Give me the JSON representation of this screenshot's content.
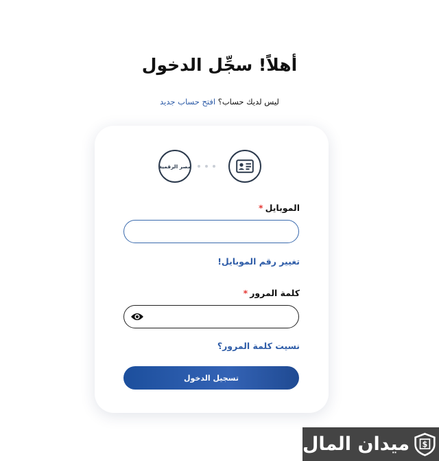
{
  "header": {
    "title": "أهلاً! سجِّل الدخول",
    "no_account_text": "ليس لديك حساب؟",
    "create_account_link": "افتح حساب جديد"
  },
  "steps": {
    "id_icon": "id-card-icon",
    "egypt_digital_label": "مصر الرقمية"
  },
  "form": {
    "mobile_label": "الموبايل",
    "mobile_value": "",
    "required_mark": "*",
    "change_mobile_link": "تغيير رقم الموبايل!",
    "password_label": "كلمة المرور",
    "password_value": "",
    "password_toggle_icon": "eye-icon",
    "forgot_password_link": "نسيت كلمة المرور؟",
    "login_button": "تسجيل الدخول"
  },
  "watermark": {
    "text": "ميدان المال"
  },
  "colors": {
    "accent": "#2f5da8",
    "button_gradient_start": "#1c4f9d",
    "button_gradient_end": "#3463b5",
    "required": "#e53935",
    "circle_border": "#2c3a4d"
  }
}
